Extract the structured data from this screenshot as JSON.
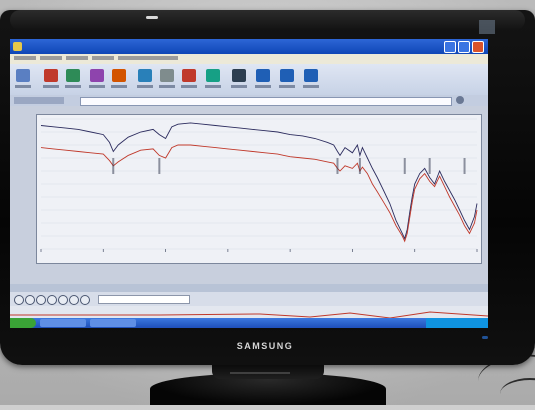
{
  "monitor": {
    "brand": "SAMSUNG",
    "bezel_color": "#0a0a0a",
    "led_color": "#2a6fd0"
  },
  "window": {
    "titlebar_color": "#1a55c8",
    "toolbar_icon_colors": [
      "#5a7fc2",
      "#c0392b",
      "#2e8b57",
      "#8e44ad",
      "#d35400",
      "#2980b9",
      "#7f8c8d",
      "#c0392b",
      "#16a085",
      "#2c3e50",
      "#1f5fb5",
      "#1f5fb5",
      "#1f5fb5"
    ]
  },
  "chart_data": {
    "type": "line",
    "xlim": [
      4000,
      500
    ],
    "ylim": [
      0,
      100
    ],
    "x_ticks": [
      4000,
      3500,
      3000,
      2500,
      2000,
      1500,
      1000,
      500
    ],
    "grid": true,
    "series": [
      {
        "color": "#2c2c5e",
        "x": [
          4000,
          3900,
          3800,
          3700,
          3600,
          3500,
          3450,
          3420,
          3380,
          3300,
          3200,
          3100,
          3050,
          3000,
          2950,
          2900,
          2800,
          2700,
          2600,
          2500,
          2400,
          2300,
          2200,
          2100,
          2050,
          2000,
          1900,
          1800,
          1700,
          1650,
          1620,
          1600,
          1560,
          1500,
          1460,
          1440,
          1420,
          1380,
          1340,
          1300,
          1250,
          1200,
          1150,
          1100,
          1080,
          1060,
          1040,
          1020,
          1000,
          960,
          920,
          880,
          840,
          800,
          760,
          720,
          680,
          640,
          600,
          560,
          520,
          500
        ],
        "y": [
          95,
          94,
          93,
          92,
          90,
          88,
          82,
          75,
          80,
          86,
          90,
          92,
          88,
          85,
          94,
          96,
          97,
          96,
          95,
          94,
          93,
          92,
          91,
          90,
          89,
          88,
          87,
          85,
          82,
          80,
          75,
          72,
          78,
          74,
          80,
          72,
          78,
          70,
          62,
          55,
          45,
          35,
          22,
          12,
          8,
          15,
          28,
          40,
          50,
          58,
          62,
          55,
          50,
          60,
          52,
          45,
          38,
          30,
          22,
          15,
          25,
          35
        ]
      },
      {
        "color": "#c0392b",
        "x": [
          4000,
          3900,
          3800,
          3700,
          3600,
          3500,
          3450,
          3420,
          3380,
          3300,
          3200,
          3100,
          3050,
          3000,
          2950,
          2900,
          2800,
          2700,
          2600,
          2500,
          2400,
          2300,
          2200,
          2100,
          2050,
          2000,
          1900,
          1800,
          1700,
          1650,
          1620,
          1600,
          1560,
          1500,
          1460,
          1440,
          1420,
          1380,
          1340,
          1300,
          1250,
          1200,
          1150,
          1100,
          1080,
          1060,
          1040,
          1020,
          1000,
          960,
          920,
          880,
          840,
          800,
          760,
          720,
          680,
          640,
          600,
          560,
          520,
          500
        ],
        "y": [
          78,
          77,
          76,
          75,
          74,
          73,
          68,
          64,
          67,
          72,
          76,
          77,
          72,
          70,
          78,
          80,
          80,
          79,
          78,
          77,
          76,
          75,
          74,
          73,
          72,
          71,
          70,
          69,
          67,
          66,
          62,
          60,
          64,
          62,
          66,
          60,
          63,
          58,
          50,
          44,
          36,
          28,
          18,
          10,
          6,
          12,
          24,
          36,
          46,
          54,
          58,
          52,
          48,
          56,
          48,
          40,
          33,
          26,
          18,
          12,
          20,
          30
        ]
      }
    ]
  }
}
